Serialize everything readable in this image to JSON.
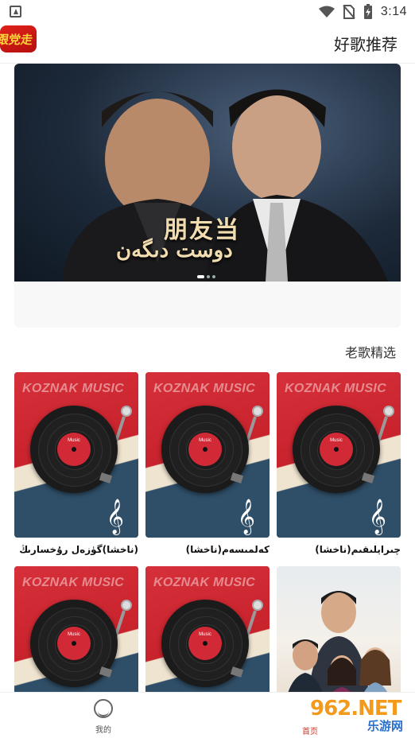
{
  "status_bar": {
    "time": "3:14",
    "icons": [
      "notification-icon",
      "wifi-icon",
      "no-sim-icon",
      "battery-charging-icon"
    ]
  },
  "header": {
    "logo_text": "跟党走",
    "title": "好歌推荐"
  },
  "banner": {
    "title_cn": "朋友当",
    "title_ug": "دوست دىگەن",
    "dots": 3,
    "active_dot": 0
  },
  "section": {
    "title": "老歌精选"
  },
  "songs": [
    {
      "title": "چىرايلىقىم(ناخشا)",
      "brand": "KOZNAK MUSIC",
      "label": "Music"
    },
    {
      "title": "كەلمىسەم(ناخشا)",
      "brand": "KOZNAK MUSIC",
      "label": "Music"
    },
    {
      "title": "(ناخشا)گۈزەل رۇخسارىڭ",
      "brand": "KOZNAK MUSIC",
      "label": "Music"
    },
    {
      "title": "",
      "brand": "",
      "label": "",
      "photo": true
    },
    {
      "title": "",
      "brand": "KOZNAK MUSIC",
      "label": "Music"
    },
    {
      "title": "",
      "brand": "KOZNAK MUSIC",
      "label": "Music"
    }
  ],
  "bottom_nav": {
    "me_label": "我的",
    "home_label": "首页"
  },
  "watermark": {
    "number": "962.NET",
    "text": "乐游网"
  },
  "colors": {
    "record_red": "#c8232c",
    "record_blue": "#2f4e67",
    "cream": "#efe4d0",
    "watermark_orange": "#f39a1c"
  }
}
